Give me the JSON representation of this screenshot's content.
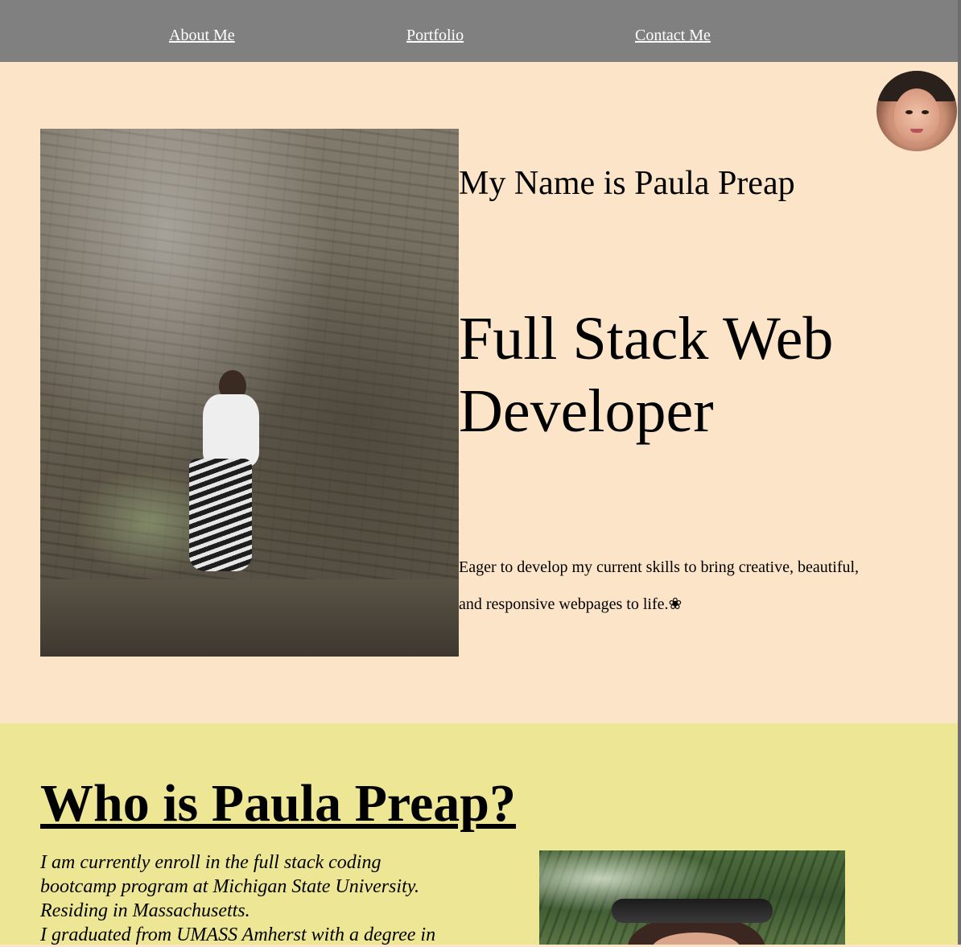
{
  "nav": {
    "about_label": "About Me",
    "portfolio_label": "Portfolio",
    "contact_label": "Contact Me"
  },
  "hero": {
    "name_heading": "My Name is Paula Preap",
    "title": "Full Stack Web Developer",
    "tagline": "Eager to develop my current skills to bring creative, beautiful, and responsive webpages to life.❀"
  },
  "about": {
    "heading": "Who is Paula Preap?",
    "lines": [
      "I am currently enroll in the full stack coding",
      "bootcamp program at Michigan State University.",
      "Residing in Massachusetts.",
      "I graduated from UMASS Amherst with a degree in"
    ]
  },
  "colors": {
    "nav_background": "#808080",
    "hero_background": "#fbe4c8",
    "about_background": "#ede694",
    "text": "#000000",
    "nav_link": "#ffffff"
  },
  "icons": {
    "tagline_flower": "flower-glyph"
  }
}
